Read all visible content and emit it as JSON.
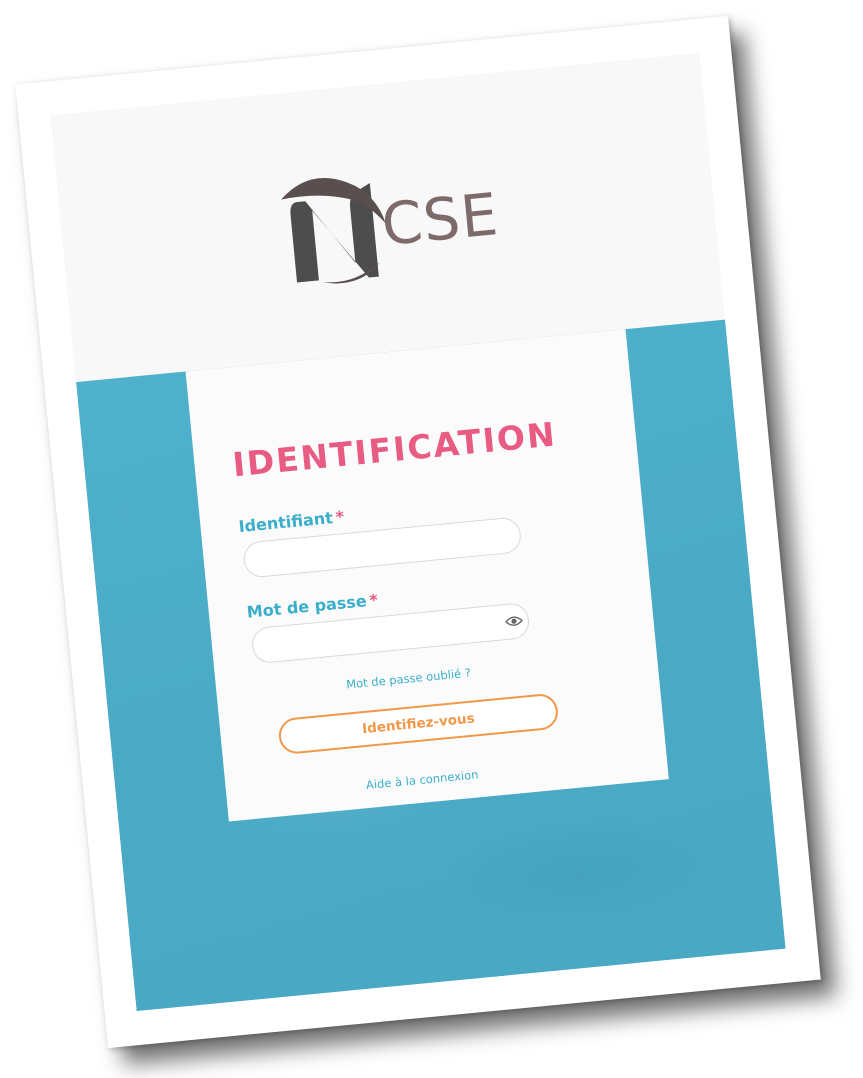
{
  "brand": {
    "logo_text": "CSE",
    "logo_mark": "N"
  },
  "login": {
    "title": "IDENTIFICATION",
    "username": {
      "label": "Identifiant",
      "required_mark": "*",
      "value": ""
    },
    "password": {
      "label": "Mot de passe",
      "required_mark": "*",
      "value": "",
      "toggle_icon": "eye-icon"
    },
    "forgot_link": "Mot de passe oublié ?",
    "submit_label": "Identifiez-vous",
    "help_link": "Aide à la connexion"
  },
  "colors": {
    "accent_pink": "#e85b82",
    "label_teal": "#3aaecb",
    "button_orange": "#f2984a",
    "background_teal": "#4aaac6",
    "logo_grey": "#4d4d4d",
    "logo_brown": "#7d6b6b"
  }
}
